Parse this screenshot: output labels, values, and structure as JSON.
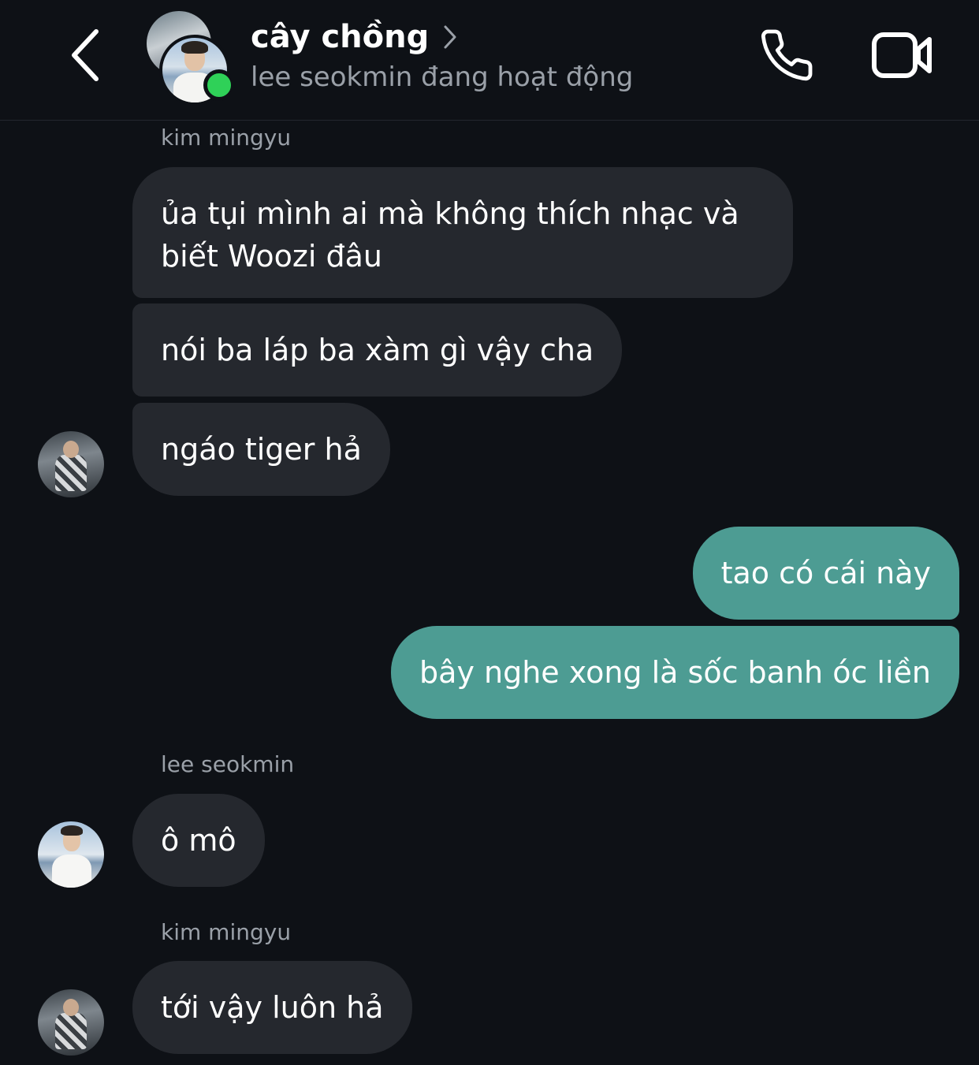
{
  "header": {
    "title": "cây chồng",
    "status": "lee seokmin đang hoạt động",
    "icons": {
      "back": "chevron-left-icon",
      "title_chevron": "chevron-right-icon",
      "call": "phone-icon",
      "video": "video-camera-icon"
    },
    "online_color": "#2fd158"
  },
  "colors": {
    "background": "#0e1116",
    "incoming_bubble": "#25282e",
    "outgoing_bubble": "#4d9c93",
    "secondary_text": "#9aa0a8"
  },
  "messages": {
    "sender_1": "kim mingyu",
    "m1": "ủa tụi mình ai mà không thích nhạc và biết Woozi đâu",
    "m2": "nói ba láp ba xàm gì vậy cha",
    "m3": "ngáo tiger hả",
    "m4": "tao có cái này",
    "m5": "bây nghe xong là sốc banh óc liền",
    "sender_2": "lee seokmin",
    "m6": "ô mô",
    "sender_3": "kim mingyu",
    "m7": "tới vậy luôn hả"
  }
}
